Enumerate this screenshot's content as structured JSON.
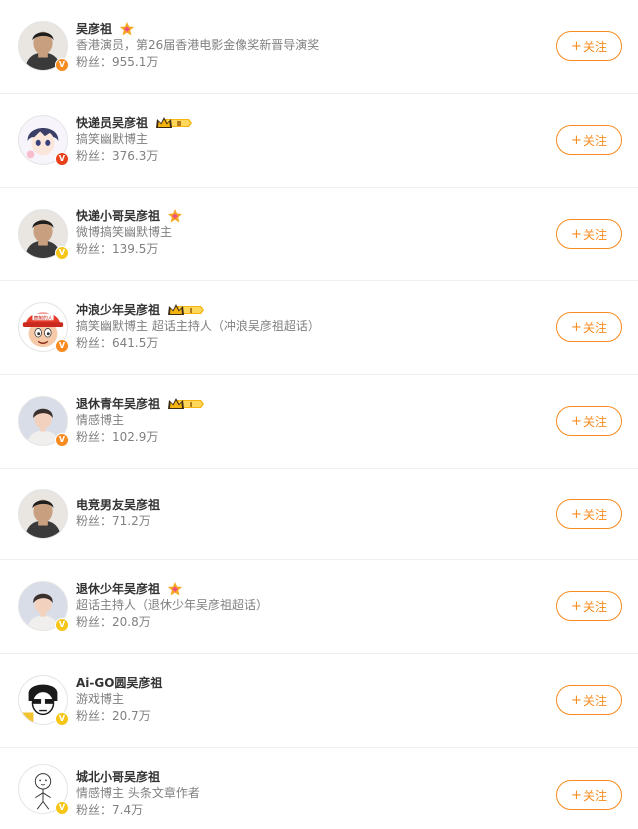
{
  "users": [
    {
      "name": "吴彦祖",
      "desc": "香港演员，第26届香港电影金像奖新晋导演奖",
      "fans": "粉丝：955.1万",
      "badge": "vip-star",
      "verify": "orange",
      "avatar": "man-photo",
      "follow": "关注"
    },
    {
      "name": "快递员吴彦祖",
      "desc": "搞笑幽默博主",
      "fans": "粉丝：376.3万",
      "badge": "crown-level",
      "badge_level": "Ⅱ",
      "verify": "red",
      "avatar": "anime-boy",
      "follow": "关注"
    },
    {
      "name": "快递小哥吴彦祖",
      "desc": "微博搞笑幽默博主",
      "fans": "粉丝：139.5万",
      "badge": "vip-star",
      "verify": "gold",
      "avatar": "man-photo",
      "follow": "关注"
    },
    {
      "name": "冲浪少年吴彦祖",
      "desc": "搞笑幽默博主 超话主持人（冲浪吴彦祖超话）",
      "fans": "粉丝：641.5万",
      "badge": "crown-level",
      "badge_level": "Ⅰ",
      "verify": "orange",
      "avatar": "cartoon-cap",
      "avatar_text": "鹿鲍的人",
      "follow": "关注"
    },
    {
      "name": "退休青年吴彦祖",
      "desc": "情感博主",
      "fans": "粉丝：102.9万",
      "badge": "crown-level",
      "badge_level": "Ⅰ",
      "verify": "orange",
      "avatar": "illustrated-boy",
      "follow": "关注"
    },
    {
      "name": "电竞男友吴彦祖",
      "desc": "",
      "fans": "粉丝：71.2万",
      "badge": "",
      "verify": "",
      "avatar": "man-photo",
      "follow": "关注"
    },
    {
      "name": "退休少年吴彦祖",
      "desc": "超话主持人（退休少年吴彦祖超话）",
      "fans": "粉丝：20.8万",
      "badge": "vip-star",
      "verify": "gold",
      "avatar": "illustrated-boy",
      "follow": "关注"
    },
    {
      "name": "Ai-GO圆吴彦祖",
      "desc": "游戏博主",
      "fans": "粉丝：20.7万",
      "badge": "",
      "verify": "gold",
      "avatar": "sketch-man",
      "follow": "关注"
    },
    {
      "name": "城北小哥吴彦祖",
      "desc": "情感博主 头条文章作者",
      "fans": "粉丝：7.4万",
      "badge": "",
      "verify": "gold",
      "avatar": "doodle",
      "follow": "关注"
    }
  ],
  "colors": {
    "accent": "#f78b1f",
    "verify_orange": "#f78b1f",
    "verify_red": "#e8401b",
    "verify_gold": "#f5c518",
    "text_primary": "#333333",
    "text_secondary": "#808080"
  }
}
